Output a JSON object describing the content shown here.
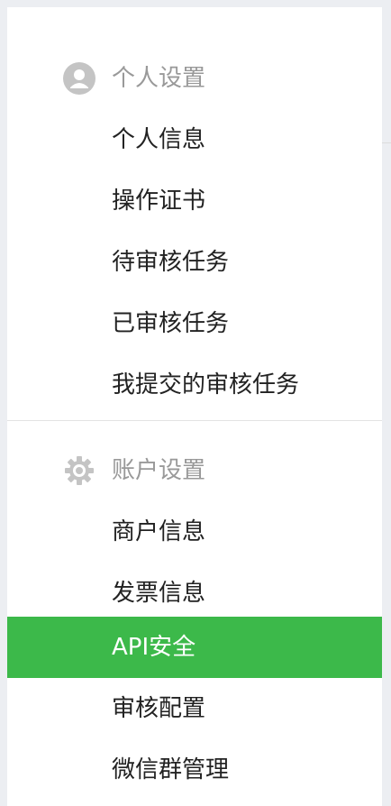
{
  "sections": [
    {
      "title": "个人设置",
      "icon": "user-avatar-icon",
      "items": [
        {
          "label": "个人信息"
        },
        {
          "label": "操作证书"
        },
        {
          "label": "待审核任务"
        },
        {
          "label": "已审核任务"
        },
        {
          "label": "我提交的审核任务"
        }
      ]
    },
    {
      "title": "账户设置",
      "icon": "gear-icon",
      "items": [
        {
          "label": "商户信息"
        },
        {
          "label": "发票信息"
        },
        {
          "label": "API安全",
          "active": true
        },
        {
          "label": "审核配置"
        },
        {
          "label": "微信群管理"
        }
      ]
    }
  ],
  "colors": {
    "active_background": "#3cb94a",
    "active_text": "#ffffff",
    "header_text": "#999999",
    "item_text": "#222222",
    "icon_gray": "#c4c4c4"
  }
}
